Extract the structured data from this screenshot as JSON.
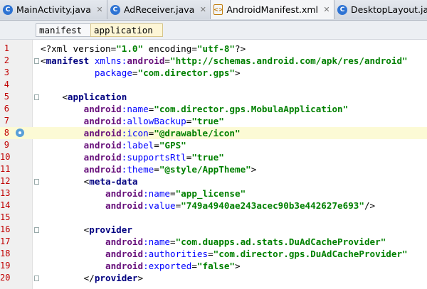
{
  "tabs": [
    {
      "label": "MainActivity.java",
      "kind": "java"
    },
    {
      "label": "AdReceiver.java",
      "kind": "java"
    },
    {
      "label": "AndroidManifest.xml",
      "kind": "xml",
      "active": true
    },
    {
      "label": "DesktopLayout.java",
      "kind": "java"
    }
  ],
  "breadcrumbs": [
    "manifest",
    "application"
  ],
  "current_line": 8,
  "lines": [
    {
      "n": "1",
      "code": [
        [
          "t-plain",
          "<?xml version="
        ],
        [
          "t-val",
          "\"1.0\""
        ],
        [
          "t-plain",
          " encoding="
        ],
        [
          "t-val",
          "\"utf-8\""
        ],
        [
          "t-plain",
          "?>"
        ]
      ]
    },
    {
      "n": "2",
      "code": [
        [
          "t-plain",
          "<"
        ],
        [
          "t-tag",
          "manifest "
        ],
        [
          "t-attr",
          "xmlns:"
        ],
        [
          "t-an",
          "android"
        ],
        [
          "t-plain",
          "="
        ],
        [
          "t-val",
          "\"http://schemas.android.com/apk/res/android\""
        ]
      ]
    },
    {
      "n": "3",
      "code": [
        [
          "t-plain",
          "          "
        ],
        [
          "t-attr",
          "package"
        ],
        [
          "t-plain",
          "="
        ],
        [
          "t-val",
          "\"com.director.gps\""
        ],
        [
          "t-plain",
          ">"
        ]
      ]
    },
    {
      "n": "4",
      "code": []
    },
    {
      "n": "5",
      "code": [
        [
          "t-plain",
          "    <"
        ],
        [
          "t-tag",
          "application"
        ]
      ]
    },
    {
      "n": "6",
      "code": [
        [
          "t-plain",
          "        "
        ],
        [
          "t-an",
          "android"
        ],
        [
          "t-attr",
          ":name"
        ],
        [
          "t-plain",
          "="
        ],
        [
          "t-val",
          "\"com.director.gps.MobulaApplication\""
        ]
      ]
    },
    {
      "n": "7",
      "code": [
        [
          "t-plain",
          "        "
        ],
        [
          "t-an",
          "android"
        ],
        [
          "t-attr",
          ":allowBackup"
        ],
        [
          "t-plain",
          "="
        ],
        [
          "t-val",
          "\"true\""
        ]
      ]
    },
    {
      "n": "8",
      "code": [
        [
          "t-plain",
          "        "
        ],
        [
          "t-an",
          "android"
        ],
        [
          "t-attr",
          ":icon"
        ],
        [
          "t-plain",
          "="
        ],
        [
          "t-val",
          "\"@drawable/icon\""
        ]
      ]
    },
    {
      "n": "9",
      "code": [
        [
          "t-plain",
          "        "
        ],
        [
          "t-an",
          "android"
        ],
        [
          "t-attr",
          ":label"
        ],
        [
          "t-plain",
          "="
        ],
        [
          "t-val",
          "\"GPS\""
        ]
      ]
    },
    {
      "n": "10",
      "code": [
        [
          "t-plain",
          "        "
        ],
        [
          "t-an",
          "android"
        ],
        [
          "t-attr",
          ":supportsRtl"
        ],
        [
          "t-plain",
          "="
        ],
        [
          "t-val",
          "\"true\""
        ]
      ]
    },
    {
      "n": "11",
      "code": [
        [
          "t-plain",
          "        "
        ],
        [
          "t-an",
          "android"
        ],
        [
          "t-attr",
          ":theme"
        ],
        [
          "t-plain",
          "="
        ],
        [
          "t-val",
          "\"@style/AppTheme\""
        ],
        [
          "t-plain",
          ">"
        ]
      ]
    },
    {
      "n": "12",
      "code": [
        [
          "t-plain",
          "        <"
        ],
        [
          "t-tag",
          "meta-data"
        ]
      ]
    },
    {
      "n": "13",
      "code": [
        [
          "t-plain",
          "            "
        ],
        [
          "t-an",
          "android"
        ],
        [
          "t-attr",
          ":name"
        ],
        [
          "t-plain",
          "="
        ],
        [
          "t-val",
          "\"app_license\""
        ]
      ]
    },
    {
      "n": "14",
      "code": [
        [
          "t-plain",
          "            "
        ],
        [
          "t-an",
          "android"
        ],
        [
          "t-attr",
          ":value"
        ],
        [
          "t-plain",
          "="
        ],
        [
          "t-val",
          "\"749a4940ae243acec90b3e442627e693\""
        ],
        [
          "t-plain",
          "/>"
        ]
      ]
    },
    {
      "n": "15",
      "code": []
    },
    {
      "n": "16",
      "code": [
        [
          "t-plain",
          "        <"
        ],
        [
          "t-tag",
          "provider"
        ]
      ]
    },
    {
      "n": "17",
      "code": [
        [
          "t-plain",
          "            "
        ],
        [
          "t-an",
          "android"
        ],
        [
          "t-attr",
          ":name"
        ],
        [
          "t-plain",
          "="
        ],
        [
          "t-val",
          "\"com.duapps.ad.stats.DuAdCacheProvider\""
        ]
      ]
    },
    {
      "n": "18",
      "code": [
        [
          "t-plain",
          "            "
        ],
        [
          "t-an",
          "android"
        ],
        [
          "t-attr",
          ":authorities"
        ],
        [
          "t-plain",
          "="
        ],
        [
          "t-val",
          "\"com.director.gps.DuAdCacheProvider\""
        ]
      ]
    },
    {
      "n": "19",
      "code": [
        [
          "t-plain",
          "            "
        ],
        [
          "t-an",
          "android"
        ],
        [
          "t-attr",
          ":exported"
        ],
        [
          "t-plain",
          "="
        ],
        [
          "t-val",
          "\"false\""
        ],
        [
          "t-plain",
          ">"
        ]
      ]
    },
    {
      "n": "20",
      "code": [
        [
          "t-plain",
          "        </"
        ],
        [
          "t-tag",
          "provider"
        ],
        [
          "t-plain",
          ">"
        ]
      ]
    }
  ],
  "colors": {
    "line_number": "#c00000",
    "tag": "#000080",
    "namespace": "#660e7a",
    "attribute": "#0000ff",
    "value": "#008000",
    "current_line_bg": "#fcfad5"
  },
  "icons": {
    "java_file": "java-file-icon",
    "xml_file": "xml-file-icon",
    "close": "close-icon",
    "gutter_marker": "bookmark-marker-icon"
  }
}
